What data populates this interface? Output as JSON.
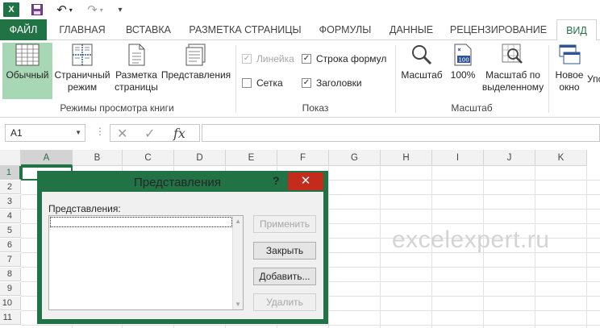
{
  "qat": {
    "app_letter": "X",
    "undo_glyph": "↶",
    "redo_glyph": "↷",
    "more_glyph": "▾"
  },
  "tabs": {
    "file": "ФАЙЛ",
    "home": "ГЛАВНАЯ",
    "insert": "ВСТАВКА",
    "page_layout": "РАЗМЕТКА СТРАНИЦЫ",
    "formulas": "ФОРМУЛЫ",
    "data": "ДАННЫЕ",
    "review": "РЕЦЕНЗИРОВАНИЕ",
    "view": "ВИД"
  },
  "ribbon": {
    "views_group": {
      "normal": "Обычный",
      "page_break_1": "Страничный",
      "page_break_2": "режим",
      "page_layout_1": "Разметка",
      "page_layout_2": "страницы",
      "custom_views": "Представления",
      "label": "Режимы просмотра книги"
    },
    "show_group": {
      "ruler": "Линейка",
      "formula_bar": "Строка формул",
      "gridlines": "Сетка",
      "headings": "Заголовки",
      "label": "Показ",
      "check_mark": "✓"
    },
    "zoom_group": {
      "zoom": "Масштаб",
      "zoom_100": "100%",
      "zoom_selection_1": "Масштаб по",
      "zoom_selection_2": "выделенному",
      "label": "Масштаб"
    },
    "window_group": {
      "new_window_1": "Новое",
      "new_window_2": "окно",
      "next_partial": "Упо"
    }
  },
  "formula_bar": {
    "name_box": "A1",
    "fx": "fx",
    "cancel": "✕",
    "enter": "✓",
    "dots": "⋮"
  },
  "grid": {
    "columns": [
      "A",
      "B",
      "C",
      "D",
      "E",
      "F",
      "G",
      "H",
      "I",
      "J",
      "K"
    ],
    "rows": [
      "1",
      "2",
      "3",
      "4",
      "5",
      "6",
      "7",
      "8",
      "9",
      "10",
      "11"
    ]
  },
  "watermark": "excelexpert.ru",
  "dialog": {
    "title": "Представления",
    "help": "?",
    "close": "✕",
    "list_label": "Представления:",
    "buttons": {
      "apply": "Применить",
      "close": "Закрыть",
      "add": "Добавить...",
      "delete": "Удалить"
    }
  },
  "colors": {
    "accent": "#217346",
    "close_red": "#c42b1c",
    "selected_button": "#a8d7b5"
  }
}
